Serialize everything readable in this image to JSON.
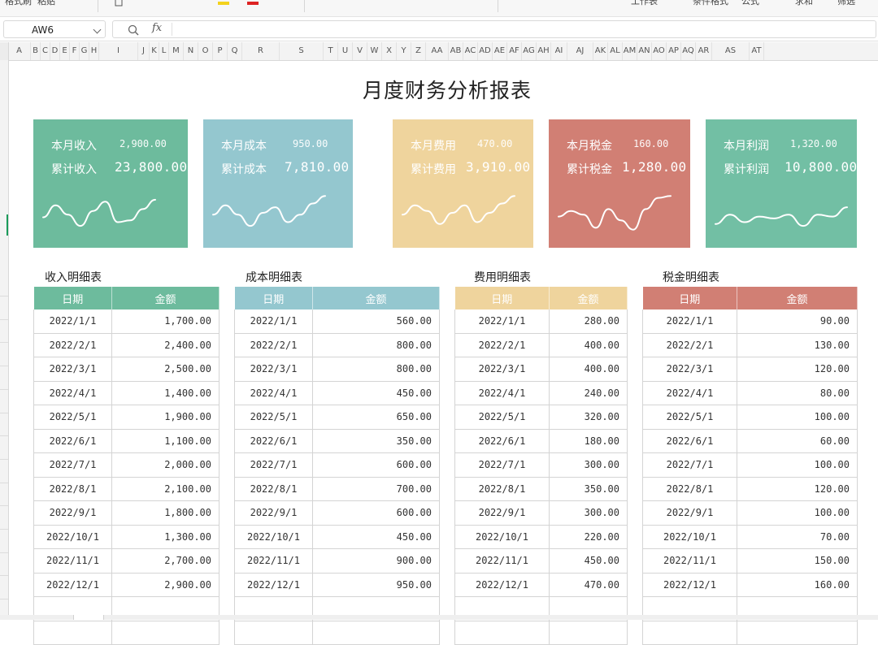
{
  "toolbar": {
    "left_labels": [
      "格式刷",
      "粘贴"
    ],
    "right_labels": [
      "工作表",
      "条件格式",
      "公式",
      "求和",
      "筛选"
    ]
  },
  "formula_bar": {
    "cell_ref": "AW6",
    "fx_label": "fx",
    "formula": ""
  },
  "columns": [
    "A",
    "B",
    "C",
    "D",
    "E",
    "F",
    "G",
    "H",
    "I",
    "J",
    "K",
    "L",
    "M",
    "N",
    "O",
    "P",
    "Q",
    "R",
    "S",
    "T",
    "U",
    "V",
    "W",
    "X",
    "Y",
    "Z",
    "AA",
    "AB",
    "AC",
    "AD",
    "AE",
    "AF",
    "AG",
    "AH",
    "AI",
    "AJ",
    "AK",
    "AL",
    "AM",
    "AN",
    "AO",
    "AP",
    "AQ",
    "AR",
    "AS",
    "AT"
  ],
  "sheet": {
    "title": "月度财务分析报表",
    "cards": [
      {
        "month_label": "本月收入",
        "month_value": "2,900.00",
        "total_label": "累计收入",
        "total_value": "23,800.00",
        "color": "#6dbb9d",
        "trend": [
          0.62,
          0.3,
          0.55,
          0.85,
          0.45,
          0.2,
          0.75,
          0.7,
          0.4,
          0.15
        ]
      },
      {
        "month_label": "本月成本",
        "month_value": "950.00",
        "total_label": "累计成本",
        "total_value": "7,810.00",
        "color": "#94c7cf",
        "trend": [
          0.55,
          0.3,
          0.55,
          0.85,
          0.5,
          0.35,
          0.75,
          0.55,
          0.25,
          0.05
        ]
      },
      {
        "month_label": "本月费用",
        "month_value": "470.00",
        "total_label": "累计费用",
        "total_value": "3,910.00",
        "color": "#efd49d",
        "trend": [
          0.55,
          0.3,
          0.45,
          0.8,
          0.5,
          0.3,
          0.75,
          0.5,
          0.25,
          0.05
        ]
      },
      {
        "month_label": "本月税金",
        "month_value": "160.00",
        "total_label": "累计税金",
        "total_value": "1,280.00",
        "color": "#d17f74",
        "trend": [
          0.6,
          0.45,
          0.55,
          0.9,
          0.4,
          0.7,
          0.95,
          0.4,
          0.1,
          0.05
        ]
      },
      {
        "month_label": "本月利润",
        "month_value": "1,320.00",
        "total_label": "累计利润",
        "total_value": "10,800.00",
        "color": "#72bfa4",
        "trend": [
          0.8,
          0.55,
          0.75,
          0.6,
          0.65,
          0.55,
          0.85,
          0.55,
          0.6,
          0.35
        ]
      }
    ],
    "tables": [
      {
        "title": "收入明细表",
        "color": "#6dbb9d",
        "header_date": "日期",
        "header_amount": "金额",
        "rows": [
          [
            "2022/1/1",
            "1,700.00"
          ],
          [
            "2022/2/1",
            "2,400.00"
          ],
          [
            "2022/3/1",
            "2,500.00"
          ],
          [
            "2022/4/1",
            "1,400.00"
          ],
          [
            "2022/5/1",
            "1,900.00"
          ],
          [
            "2022/6/1",
            "1,100.00"
          ],
          [
            "2022/7/1",
            "2,000.00"
          ],
          [
            "2022/8/1",
            "2,100.00"
          ],
          [
            "2022/9/1",
            "1,800.00"
          ],
          [
            "2022/10/1",
            "1,300.00"
          ],
          [
            "2022/11/1",
            "2,700.00"
          ],
          [
            "2022/12/1",
            "2,900.00"
          ]
        ]
      },
      {
        "title": "成本明细表",
        "color": "#94c7cf",
        "header_date": "日期",
        "header_amount": "金额",
        "rows": [
          [
            "2022/1/1",
            "560.00"
          ],
          [
            "2022/2/1",
            "800.00"
          ],
          [
            "2022/3/1",
            "800.00"
          ],
          [
            "2022/4/1",
            "450.00"
          ],
          [
            "2022/5/1",
            "650.00"
          ],
          [
            "2022/6/1",
            "350.00"
          ],
          [
            "2022/7/1",
            "600.00"
          ],
          [
            "2022/8/1",
            "700.00"
          ],
          [
            "2022/9/1",
            "600.00"
          ],
          [
            "2022/10/1",
            "450.00"
          ],
          [
            "2022/11/1",
            "900.00"
          ],
          [
            "2022/12/1",
            "950.00"
          ]
        ]
      },
      {
        "title": "费用明细表",
        "color": "#efd49d",
        "header_date": "日期",
        "header_amount": "金额",
        "rows": [
          [
            "2022/1/1",
            "280.00"
          ],
          [
            "2022/2/1",
            "400.00"
          ],
          [
            "2022/3/1",
            "400.00"
          ],
          [
            "2022/4/1",
            "240.00"
          ],
          [
            "2022/5/1",
            "320.00"
          ],
          [
            "2022/6/1",
            "180.00"
          ],
          [
            "2022/7/1",
            "300.00"
          ],
          [
            "2022/8/1",
            "350.00"
          ],
          [
            "2022/9/1",
            "300.00"
          ],
          [
            "2022/10/1",
            "220.00"
          ],
          [
            "2022/11/1",
            "450.00"
          ],
          [
            "2022/12/1",
            "470.00"
          ]
        ]
      },
      {
        "title": "税金明细表",
        "color": "#d17f74",
        "header_date": "日期",
        "header_amount": "金额",
        "rows": [
          [
            "2022/1/1",
            "90.00"
          ],
          [
            "2022/2/1",
            "130.00"
          ],
          [
            "2022/3/1",
            "120.00"
          ],
          [
            "2022/4/1",
            "80.00"
          ],
          [
            "2022/5/1",
            "100.00"
          ],
          [
            "2022/6/1",
            "60.00"
          ],
          [
            "2022/7/1",
            "100.00"
          ],
          [
            "2022/8/1",
            "120.00"
          ],
          [
            "2022/9/1",
            "100.00"
          ],
          [
            "2022/10/1",
            "70.00"
          ],
          [
            "2022/11/1",
            "150.00"
          ],
          [
            "2022/12/1",
            "160.00"
          ]
        ]
      }
    ]
  }
}
